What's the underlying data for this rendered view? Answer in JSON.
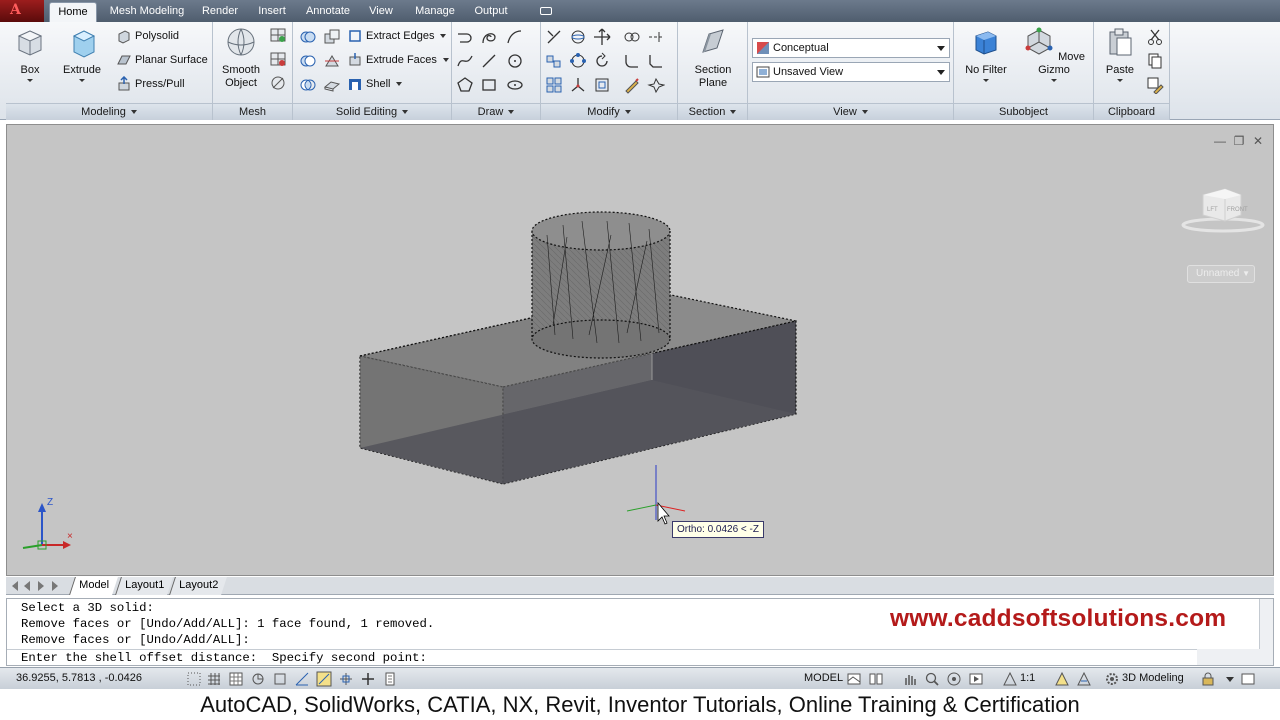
{
  "tabs": [
    "Home",
    "Mesh Modeling",
    "Render",
    "Insert",
    "Annotate",
    "View",
    "Manage",
    "Output"
  ],
  "active_tab": "Home",
  "panels": {
    "modeling": {
      "title": "Modeling",
      "box": "Box",
      "extrude": "Extrude",
      "polysolid": "Polysolid",
      "planar_surface": "Planar Surface",
      "press_pull": "Press/Pull"
    },
    "mesh": {
      "title": "Mesh",
      "smooth_object_1": "Smooth",
      "smooth_object_2": "Object"
    },
    "solid_editing": {
      "title": "Solid Editing",
      "extract_edges": "Extract Edges",
      "extrude_faces": "Extrude Faces",
      "shell": "Shell"
    },
    "draw": {
      "title": "Draw"
    },
    "modify": {
      "title": "Modify"
    },
    "section": {
      "title": "Section",
      "section_plane_1": "Section",
      "section_plane_2": "Plane"
    },
    "view": {
      "title": "View",
      "visual_style": "Conceptual",
      "saved_view": "Unsaved View"
    },
    "subobject": {
      "title": "Subobject",
      "no_filter": "No Filter",
      "move_gizmo": "Move Gizmo"
    },
    "clipboard": {
      "title": "Clipboard",
      "paste": "Paste"
    }
  },
  "viewport": {
    "viewcube_left": "LFT",
    "viewcube_front": "FRONT",
    "ucs_label": "Unnamed",
    "tooltip": "Ortho: 0.0426 < -Z",
    "axis_z": "Z"
  },
  "layout_tabs": [
    "Model",
    "Layout1",
    "Layout2"
  ],
  "command_lines": [
    "Select a 3D solid:",
    "Remove faces or [Undo/Add/ALL]: 1 face found, 1 removed.",
    "Remove faces or [Undo/Add/ALL]:",
    "Enter the shell offset distance:  Specify second point:"
  ],
  "watermark": "www.caddsoftsolutions.com",
  "status": {
    "coordinates": "36.9255, 5.7813 , -0.0426",
    "model": "MODEL",
    "scale": "1:1",
    "workspace": "3D Modeling"
  },
  "footer": "AutoCAD, SolidWorks, CATIA, NX, Revit, Inventor Tutorials, Online Training & Certification"
}
